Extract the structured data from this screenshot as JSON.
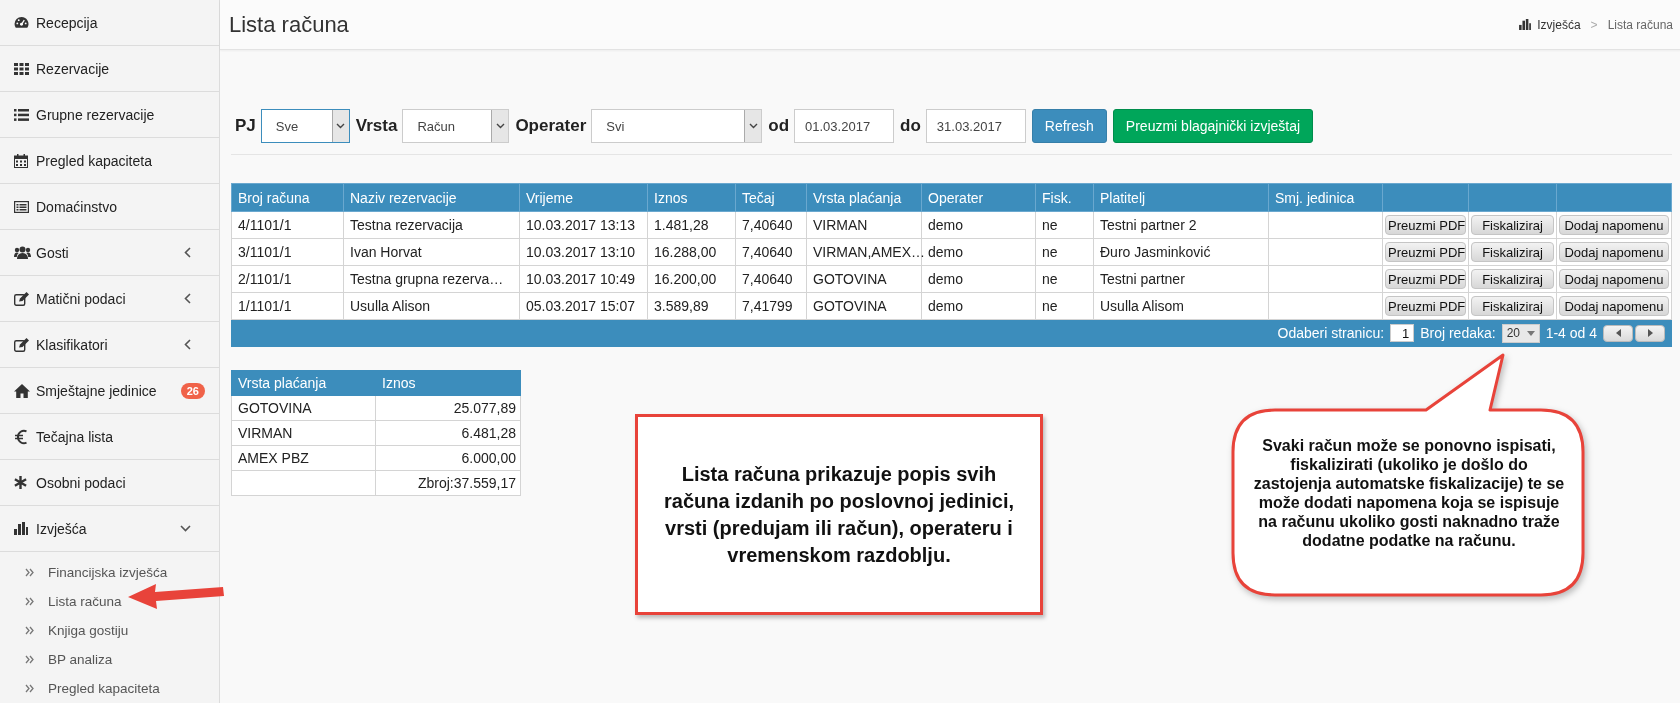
{
  "sidebar": {
    "items": [
      {
        "label": "Recepcija"
      },
      {
        "label": "Rezervacije"
      },
      {
        "label": "Grupne rezervacije"
      },
      {
        "label": "Pregled kapaciteta"
      },
      {
        "label": "Domaćinstvo"
      },
      {
        "label": "Gosti",
        "expanded": false
      },
      {
        "label": "Matični podaci",
        "expanded": false
      },
      {
        "label": "Klasifikatori",
        "expanded": false
      },
      {
        "label": "Smještajne jedinice",
        "badge": "26"
      },
      {
        "label": "Tečajna lista"
      },
      {
        "label": "Osobni podaci"
      },
      {
        "label": "Izvješća",
        "expanded": true,
        "children": [
          {
            "label": "Financijska izvješća"
          },
          {
            "label": "Lista računa"
          },
          {
            "label": "Knjiga gostiju"
          },
          {
            "label": "BP analiza"
          },
          {
            "label": "Pregled kapaciteta"
          }
        ]
      }
    ]
  },
  "header": {
    "title": "Lista računa",
    "breadcrumb": {
      "items": [
        "Izvješća",
        "Lista računa"
      ],
      "separator": ">"
    }
  },
  "filters": [
    {
      "kind": "select",
      "label": "PJ",
      "value": "Sve",
      "focused": true
    },
    {
      "kind": "select",
      "label": "Vrsta",
      "value": "Račun",
      "focused": false
    },
    {
      "kind": "select",
      "label": "Operater",
      "value": "Svi",
      "focused": false
    },
    {
      "kind": "date",
      "label": "od",
      "value": "01.03.2017",
      "focused": false
    },
    {
      "kind": "date",
      "label": "do",
      "value": "31.03.2017",
      "focused": false
    }
  ],
  "buttons": [
    {
      "kind": "primary",
      "label": "Refresh"
    },
    {
      "kind": "success",
      "label": "Preuzmi blagajnički izvještaj"
    }
  ],
  "invoices": {
    "columns": [
      "Broj računa",
      "Naziv rezervacije",
      "Vrijeme",
      "Iznos",
      "Tečaj",
      "Vrsta plaćanja",
      "Operater",
      "Fisk.",
      "Platitelj",
      "Smj. jedinica"
    ],
    "rows": [
      {
        "cells": [
          "4/1101/1",
          "Testna rezervacija",
          "10.03.2017 13:13",
          "1.481,28",
          "7,40640",
          "VIRMAN",
          "demo",
          "ne",
          "Testni partner 2"
        ],
        "actions": [
          "Preuzmi PDF",
          "Fiskaliziraj",
          "Dodaj napomenu"
        ]
      },
      {
        "cells": [
          "3/1101/1",
          "Ivan Horvat",
          "10.03.2017 13:10",
          "16.288,00",
          "7,40640",
          "VIRMAN,AMEX…",
          "demo",
          "ne",
          "Đuro Jasminković"
        ],
        "actions": [
          "Preuzmi PDF",
          "Fiskaliziraj",
          "Dodaj napomenu"
        ]
      },
      {
        "cells": [
          "2/1101/1",
          "Testna grupna rezerva…",
          "10.03.2017 10:49",
          "16.200,00",
          "7,40640",
          "GOTOVINA",
          "demo",
          "ne",
          "Testni partner"
        ],
        "actions": [
          "Preuzmi PDF",
          "Fiskaliziraj",
          "Dodaj napomenu"
        ]
      },
      {
        "cells": [
          "1/1101/1",
          "Usulla Alison",
          "05.03.2017 15:07",
          "3.589,89",
          "7,41799",
          "GOTOVINA",
          "demo",
          "ne",
          "Usulla Alisom"
        ],
        "actions": [
          "Preuzmi PDF",
          "Fiskaliziraj",
          "Dodaj napomenu"
        ]
      }
    ],
    "footer": {
      "page_label": "Odaberi stranicu:",
      "page": "1",
      "rows_label": "Broj redaka:",
      "rows_per_page": "20",
      "range": "1-4 od 4"
    }
  },
  "summary": {
    "columns": [
      "Vrsta plaćanja",
      "Iznos"
    ],
    "rows": [
      {
        "method": "GOTOVINA",
        "amount": "25.077,89"
      },
      {
        "method": "VIRMAN",
        "amount": "6.481,28"
      },
      {
        "method": "AMEX PBZ",
        "amount": "6.000,00"
      },
      {
        "amount": "Zbroj:37.559,17"
      }
    ]
  },
  "callouts": [
    {
      "kind": "box",
      "text": "Lista računa prikazuje popis svih računa izdanih po poslovnoj jedinici, vrsti (predujam ili račun), operateru i vremenskom razdoblju."
    },
    {
      "kind": "bubble",
      "text": "Svaki račun može se ponovno ispisati, fiskalizirati (ukoliko je došlo do zastojenja automatske fiskalizacije) te se može dodati napomena koja se ispisuje na računu ukoliko gosti naknadno traže dodatne podatke na računu."
    }
  ]
}
